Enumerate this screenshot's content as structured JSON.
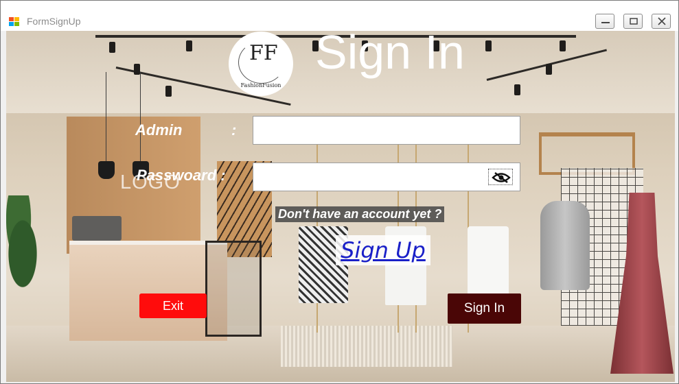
{
  "window": {
    "title": "FormSignUp",
    "controls": [
      "minimize",
      "maximize",
      "close"
    ]
  },
  "brand": {
    "monogram": "FF",
    "name": "FashionFusion"
  },
  "background": {
    "logo_text": "LOGO"
  },
  "form": {
    "heading": "Sign In",
    "admin_label": "Admin",
    "admin_colon": ":",
    "admin_value": "",
    "password_label": "Passwoard :",
    "password_value": "",
    "show_password_icon": "eye-slash-icon"
  },
  "signup_prompt": "Don't have an account yet ?",
  "signup_link": "Sign Up",
  "buttons": {
    "exit": "Exit",
    "sign_in": "Sign In"
  },
  "colors": {
    "exit_button": "#ff0c0c",
    "sign_in_button": "#4a0606",
    "signup_link": "#1a20c8"
  }
}
